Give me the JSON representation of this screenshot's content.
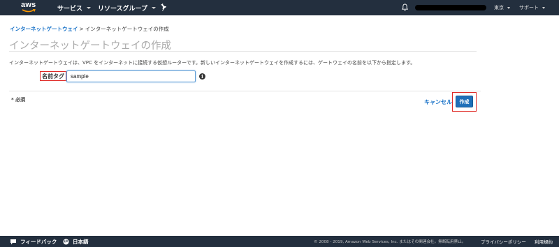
{
  "topbar": {
    "logo_text": "aws",
    "services_label": "サービス",
    "resource_groups_label": "リソースグループ",
    "region_label": "東京",
    "support_label": "サポート"
  },
  "breadcrumb": {
    "parent_label": "インターネットゲートウェイ",
    "separator": ">",
    "current_label": "インターネットゲートウェイの作成"
  },
  "page": {
    "title": "インターネットゲートウェイの作成",
    "description": "インターネットゲートウェイは、VPC をインターネットに接続する仮想ルーターです。新しいインターネットゲートウェイを作成するには、ゲートウェイの名前を以下から指定します。"
  },
  "form": {
    "name_tag_label": "名前タグ",
    "name_tag_value": "sample",
    "info_glyph": "i",
    "required_note": "* 必須"
  },
  "actions": {
    "cancel_label": "キャンセル",
    "create_label": "作成"
  },
  "footer": {
    "feedback_label": "フィードバック",
    "language_label": "日本語",
    "copyright": "© 2008 - 2019, Amazon Web Services, Inc. またはその関連会社。無断転用禁止。",
    "privacy_label": "プライバシーポリシー",
    "terms_label": "利用規約"
  },
  "colors": {
    "nav_bg": "#232f3e",
    "link_blue": "#1a73c8",
    "primary_button": "#1f6fb8",
    "highlight_red": "#e02b27"
  }
}
